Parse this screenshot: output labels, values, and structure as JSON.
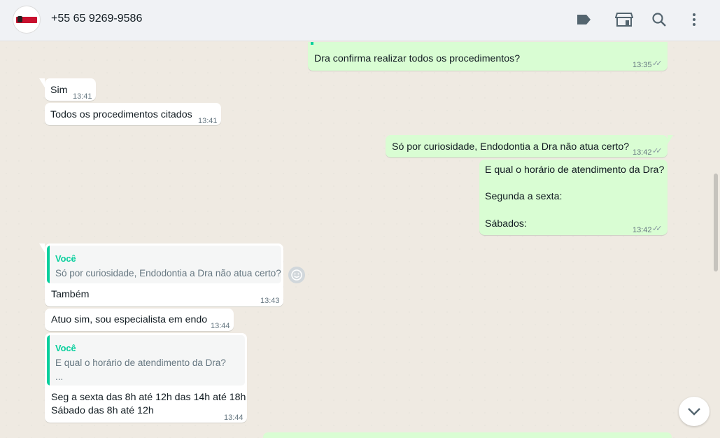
{
  "header": {
    "contact_name": "+55 65 9269-9586",
    "icons": [
      "label-icon",
      "store-icon",
      "search-icon",
      "menu-icon"
    ]
  },
  "messages": [
    {
      "dir": "out",
      "text": "Dra confirma realizar todos os procedimentos?",
      "time": "13:35",
      "status": "read"
    },
    {
      "dir": "in",
      "text": "Sim",
      "time": "13:41"
    },
    {
      "dir": "in",
      "text": "Todos os procedimentos citados",
      "time": "13:41"
    },
    {
      "dir": "out",
      "text": "Só por curiosidade, Endodontia a Dra não atua certo?",
      "time": "13:42",
      "status": "read"
    },
    {
      "dir": "out",
      "lines": [
        "E qual o horário de atendimento da Dra?",
        "",
        "Segunda a sexta:",
        "",
        "Sábados:"
      ],
      "time": "13:42",
      "status": "read"
    },
    {
      "dir": "in",
      "quote": {
        "author": "Você",
        "text": "Só por curiosidade, Endodontia a Dra não atua certo?"
      },
      "text": "Também",
      "time": "13:43"
    },
    {
      "dir": "in",
      "text": "Atuo sim, sou especialista em endo",
      "time": "13:44"
    },
    {
      "dir": "in",
      "quote": {
        "author": "Você",
        "text": "E qual o horário de atendimento da Dra?",
        "text2": "..."
      },
      "lines": [
        "Seg a sexta das 8h até 12h das 14h até 18h",
        "Sábado das 8h até 12h"
      ],
      "time": "13:44"
    }
  ],
  "colors": {
    "incoming": "#ffffff",
    "outgoing": "#d9fdd3",
    "quote_accent": "#06cf9c",
    "background": "#efeae2"
  }
}
